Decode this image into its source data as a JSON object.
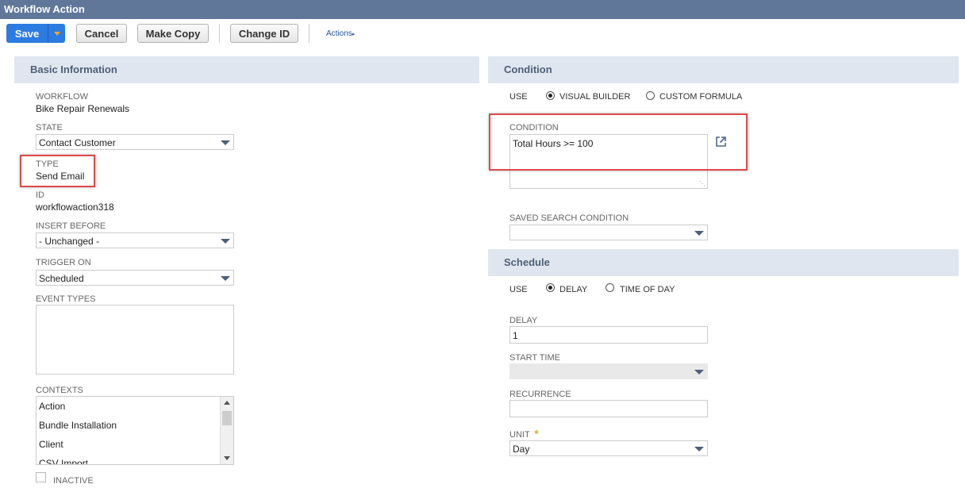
{
  "window": {
    "title": "Workflow Action"
  },
  "toolbar": {
    "save_label": "Save",
    "cancel_label": "Cancel",
    "make_copy_label": "Make Copy",
    "change_id_label": "Change ID",
    "actions_label": "Actions"
  },
  "basic": {
    "section_title": "Basic Information",
    "workflow_label": "WORKFLOW",
    "workflow_value": "Bike Repair Renewals",
    "state_label": "STATE",
    "state_value": "Contact Customer",
    "type_label": "TYPE",
    "type_value": "Send Email",
    "id_label": "ID",
    "id_value": "workflowaction318",
    "insert_before_label": "INSERT BEFORE",
    "insert_before_value": "- Unchanged -",
    "trigger_on_label": "TRIGGER ON",
    "trigger_on_value": "Scheduled",
    "event_types_label": "EVENT TYPES",
    "contexts_label": "CONTEXTS",
    "contexts": [
      "Action",
      "Bundle Installation",
      "Client",
      "CSV Import"
    ],
    "inactive_label": "INACTIVE"
  },
  "condition": {
    "section_title": "Condition",
    "use_label": "USE",
    "visual_builder_label": "VISUAL BUILDER",
    "custom_formula_label": "CUSTOM FORMULA",
    "condition_label": "CONDITION",
    "condition_value": "Total Hours >= 100",
    "saved_search_label": "SAVED SEARCH CONDITION"
  },
  "schedule": {
    "section_title": "Schedule",
    "use_label": "USE",
    "delay_option_label": "DELAY",
    "time_of_day_label": "TIME OF DAY",
    "delay_label": "DELAY",
    "delay_value": "1",
    "start_time_label": "START TIME",
    "recurrence_label": "RECURRENCE",
    "unit_label": "UNIT",
    "unit_required_mark": "*",
    "unit_value": "Day"
  },
  "colors": {
    "header": "#607799",
    "section_bg": "#e0e6ef",
    "save_blue": "#2c7be0",
    "highlight_red": "#e04a4a"
  }
}
